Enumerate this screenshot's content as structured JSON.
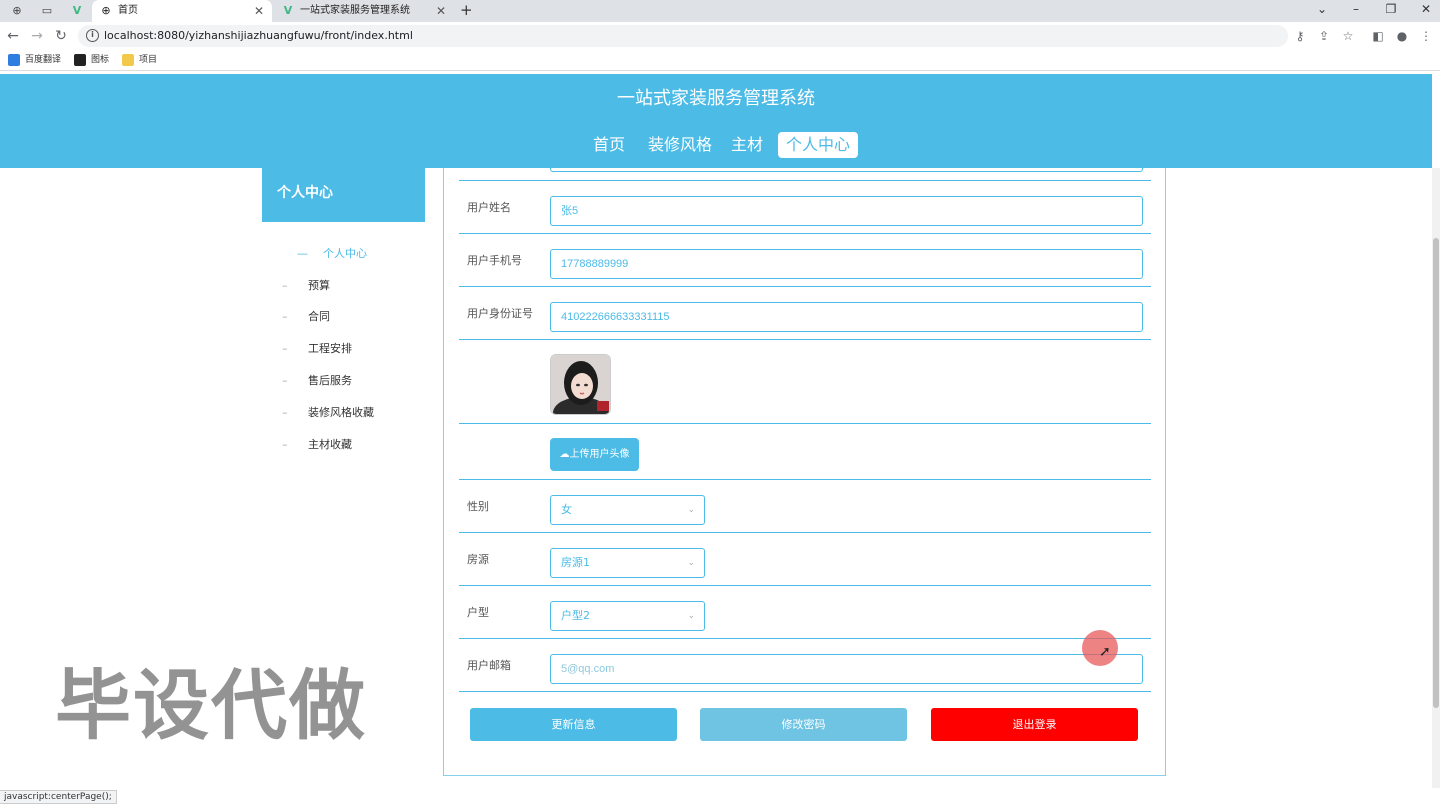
{
  "browser": {
    "tabs": [
      {
        "title": "首页"
      },
      {
        "title": "一站式家装服务管理系统"
      }
    ],
    "url": "localhost:8080/yizhanshijiazhuangfuwu/front/index.html",
    "bookmarks": [
      {
        "label": "百度翻译"
      },
      {
        "label": "图标"
      },
      {
        "label": "项目"
      }
    ],
    "status_text": "javascript:centerPage();"
  },
  "site": {
    "title": "一站式家装服务管理系统",
    "nav": [
      {
        "label": "首页"
      },
      {
        "label": "装修风格"
      },
      {
        "label": "主材"
      },
      {
        "label": "个人中心"
      }
    ]
  },
  "sidebar": {
    "title": "个人中心",
    "items": [
      {
        "label": "个人中心"
      },
      {
        "label": "预算"
      },
      {
        "label": "合同"
      },
      {
        "label": "工程安排"
      },
      {
        "label": "售后服务"
      },
      {
        "label": "装修风格收藏"
      },
      {
        "label": "主材收藏"
      }
    ]
  },
  "form": {
    "name_label": "用户姓名",
    "name_value": "张5",
    "phone_label": "用户手机号",
    "phone_value": "17788889999",
    "id_label": "用户身份证号",
    "id_value": "410222666633331115",
    "upload_label": "上传用户头像",
    "gender_label": "性别",
    "gender_value": "女",
    "house_label": "房源",
    "house_value": "房源1",
    "layout_label": "户型",
    "layout_value": "户型2",
    "email_label": "用户邮箱",
    "email_value": "5@qq.com"
  },
  "actions": {
    "update_label": "更新信息",
    "password_label": "修改密码",
    "logout_label": "退出登录",
    "colors": {
      "update": "#4cbbe6",
      "password": "#6fc4e3",
      "logout": "#ff0000"
    }
  },
  "watermark": "毕设代做",
  "theme": {
    "accent": "#4cbbe6"
  }
}
